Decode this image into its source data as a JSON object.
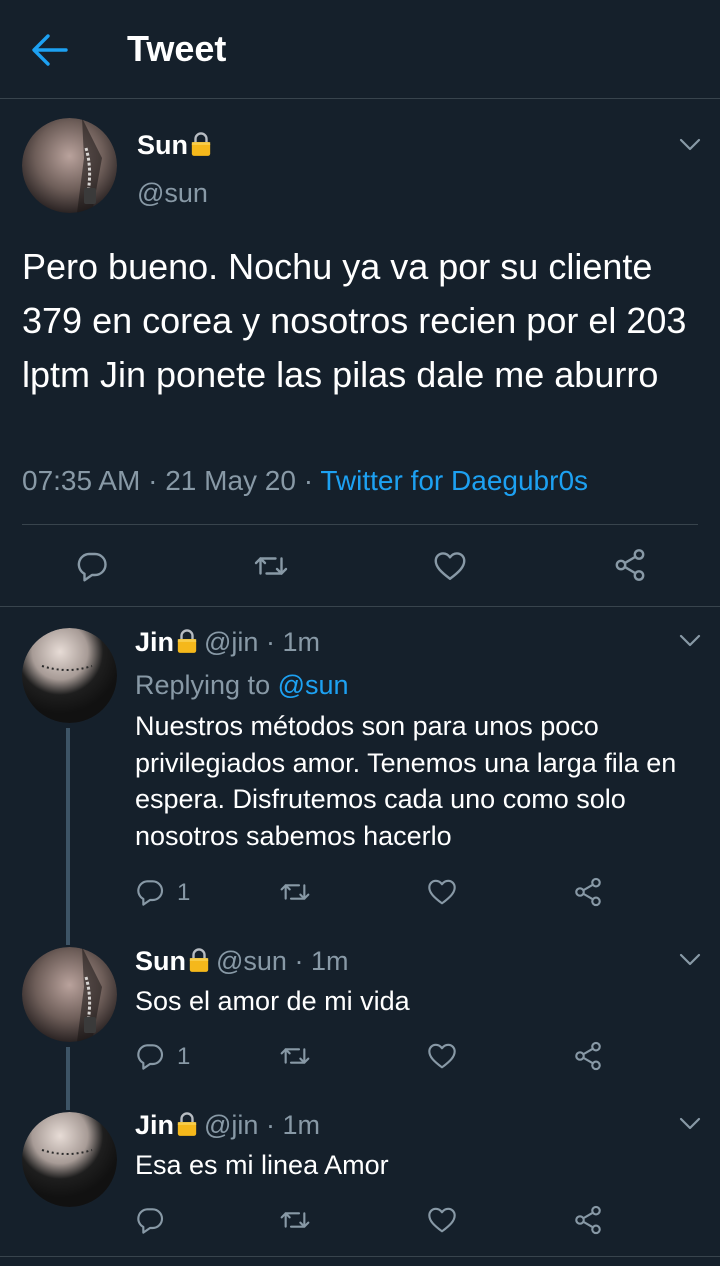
{
  "header": {
    "title": "Tweet"
  },
  "main": {
    "name": "Sun",
    "handle": "@sun",
    "text": "Pero bueno. Nochu ya va por su cliente 379 en corea y nosotros recien por el 203 lptm Jin ponete las pilas dale me aburro",
    "time": "07:35 AM",
    "sep1": " · ",
    "date": "21 May 20",
    "sep2": " · ",
    "source": "Twitter for Daegubr0s"
  },
  "replies": [
    {
      "name": "Jin",
      "handle": "@jin",
      "sep": " · ",
      "time": "1m",
      "replying_prefix": "Replying to ",
      "replying_to": "@sun",
      "text": "Nuestros métodos son para unos poco privilegiados amor. Tenemos una larga fila en espera. Disfrutemos cada uno como solo nosotros sabemos hacerlo",
      "reply_count": "1"
    },
    {
      "name": "Sun",
      "handle": "@sun",
      "sep": " · ",
      "time": "1m",
      "text": "Sos el amor de mi vida",
      "reply_count": "1"
    },
    {
      "name": "Jin",
      "handle": "@jin",
      "sep": " · ",
      "time": "1m",
      "text": "Esa es mi linea Amor",
      "reply_count": ""
    }
  ],
  "icons": {
    "back": "arrow-left-icon",
    "lock": "lock-icon",
    "chevron": "chevron-down-icon",
    "reply": "comment-icon",
    "retweet": "retweet-icon",
    "like": "heart-icon",
    "share": "share-icon"
  },
  "colors": {
    "background": "#15202b",
    "accent": "#1da1f2",
    "muted": "#8899a6",
    "divider": "#38444d",
    "lock": "#f5b81b"
  }
}
